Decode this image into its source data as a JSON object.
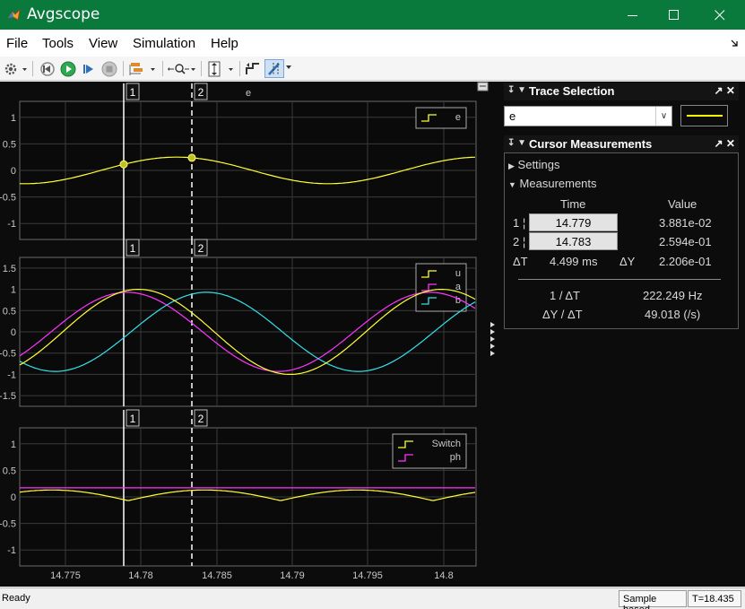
{
  "window": {
    "title": "Avgscope",
    "app_icon": "matlab-icon",
    "minimize_icon": "minimize-icon",
    "maximize_icon": "maximize-icon",
    "close_icon": "close-icon"
  },
  "menu": {
    "items": [
      "File",
      "Tools",
      "View",
      "Simulation",
      "Help"
    ],
    "overflow_icon": "pin-arrow-icon"
  },
  "toolbar": {
    "icons": [
      "settings-gear-icon",
      "step-back-icon",
      "run-icon",
      "step-forward-icon",
      "stop-icon",
      "signal-select-icon",
      "zoom-icon",
      "scale-axes-icon",
      "triggers-icon",
      "cursor-measurements-icon"
    ]
  },
  "scope": {
    "title": "e",
    "undock_icon": "undock-icon",
    "x_ticks": [
      "14.775",
      "14.78",
      "14.785",
      "14.79",
      "14.795",
      "14.8"
    ],
    "cursor_labels": [
      "1",
      "2"
    ],
    "plots": [
      {
        "name": "plot-e",
        "y_ticks": [
          "1",
          "0.5",
          "0",
          "-0.5",
          "-1"
        ],
        "legend": [
          {
            "name": "e",
            "color": "#ffff33"
          }
        ]
      },
      {
        "name": "plot-uab",
        "y_ticks": [
          "1.5",
          "1",
          "0.5",
          "0",
          "-0.5",
          "-1",
          "-1.5"
        ],
        "legend": [
          {
            "name": "u",
            "color": "#ffff33"
          },
          {
            "name": "a",
            "color": "#ff33ff"
          },
          {
            "name": "b",
            "color": "#33e0e8"
          }
        ]
      },
      {
        "name": "plot-switch",
        "y_ticks": [
          "1",
          "0.5",
          "0",
          "-0.5",
          "-1"
        ],
        "legend": [
          {
            "name": "Switch",
            "color": "#ffff33"
          },
          {
            "name": "ph",
            "color": "#ff33ff"
          }
        ]
      }
    ]
  },
  "trace_selection": {
    "title": "Trace Selection",
    "selected": "e",
    "swatch_color": "#ffff00"
  },
  "cursor_measurements": {
    "title": "Cursor Measurements",
    "settings_label": "Settings",
    "measurements_label": "Measurements",
    "col_time": "Time",
    "col_value": "Value",
    "row1_label": "1 ¦",
    "row1_time": "14.779",
    "row1_value": "3.881e-02",
    "row2_label": "2 ¦",
    "row2_time": "14.783",
    "row2_value": "2.594e-01",
    "dt_label": "ΔT",
    "dt_value": "4.499 ms",
    "dy_label": "ΔY",
    "dy_value": "2.206e-01",
    "inv_dt_label": "1 / ΔT",
    "inv_dt_value": "222.249 Hz",
    "slope_label": "ΔY / ΔT",
    "slope_value": "49.018 (/s)"
  },
  "status": {
    "ready": "Ready",
    "mode": "Sample based",
    "time": "T=18.435"
  }
}
